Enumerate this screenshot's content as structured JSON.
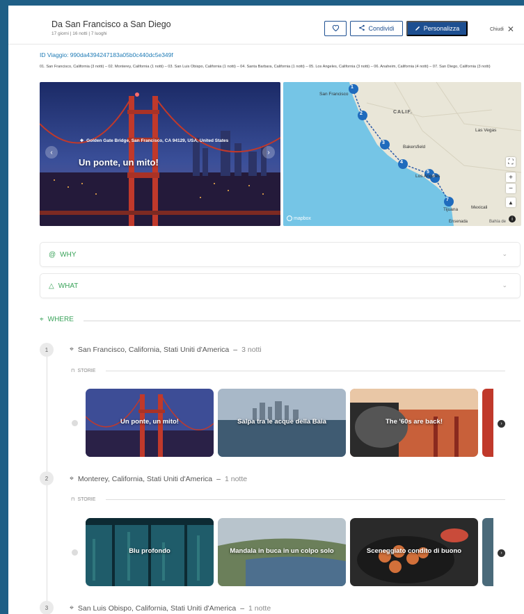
{
  "header": {
    "title": "Da San Francisco a San Diego",
    "subtitle": "17 giorni | 16 notti | 7 luoghi",
    "share_label": "Condividi",
    "customize_label": "Personalizza",
    "close_label": "Chiudi"
  },
  "trip": {
    "id_text": "ID Viaggio: 990da4394247183a05b0c440dc5e349f",
    "itinerary_text": "01. San Francisco, California (3 notti) – 02. Monterey, California (1 notti) – 03. San Luis Obispo, California (1 notti) – 04. Santa Barbara, California (1 notti) – 05. Los Angeles, California (3 notti) – 06. Anaheim, California (4 notti) – 07. San Diego, California (3 notti)"
  },
  "hero": {
    "location": "Golden Gate Bridge, San Francisco, CA 94129, USA, United States",
    "headline": "Un ponte, un mito!"
  },
  "map": {
    "labels": {
      "sf": "San Francisco",
      "calif": "CALIF.",
      "lasvegas": "Las Vegas",
      "bakersfield": "Bakersfield",
      "la": "Los Angeles",
      "tijuana": "Tijuana",
      "mexicali": "Mexicali",
      "ensenada": "Ensenada",
      "bahia": "Bahía de",
      "mapbox": "mapbox"
    },
    "markers": [
      "1",
      "2",
      "3",
      "4",
      "5",
      "6",
      "7"
    ]
  },
  "sections": {
    "why": "WHY",
    "what": "WHAT",
    "where": "WHERE",
    "store_label": "STORIE"
  },
  "stops": [
    {
      "num": "1",
      "place": "San Francisco, California, Stati Uniti d'America",
      "nights": "3 notti",
      "cards": [
        "Un ponte, un mito!",
        "Salpa tra le acque della Baia",
        "The '60s are back!"
      ]
    },
    {
      "num": "2",
      "place": "Monterey, California, Stati Uniti d'America",
      "nights": "1 notte",
      "cards": [
        "Blu profondo",
        "Mandala in buca in un colpo solo",
        "Sceneggiato condito di buono"
      ]
    },
    {
      "num": "3",
      "place": "San Luis Obispo, California, Stati Uniti d'America",
      "nights": "1 notte"
    }
  ],
  "colors": {
    "brand_blue": "#1d4f91",
    "accent_green": "#3aa35a",
    "link_blue": "#1d7ab5",
    "frame": "#1f5f86"
  }
}
